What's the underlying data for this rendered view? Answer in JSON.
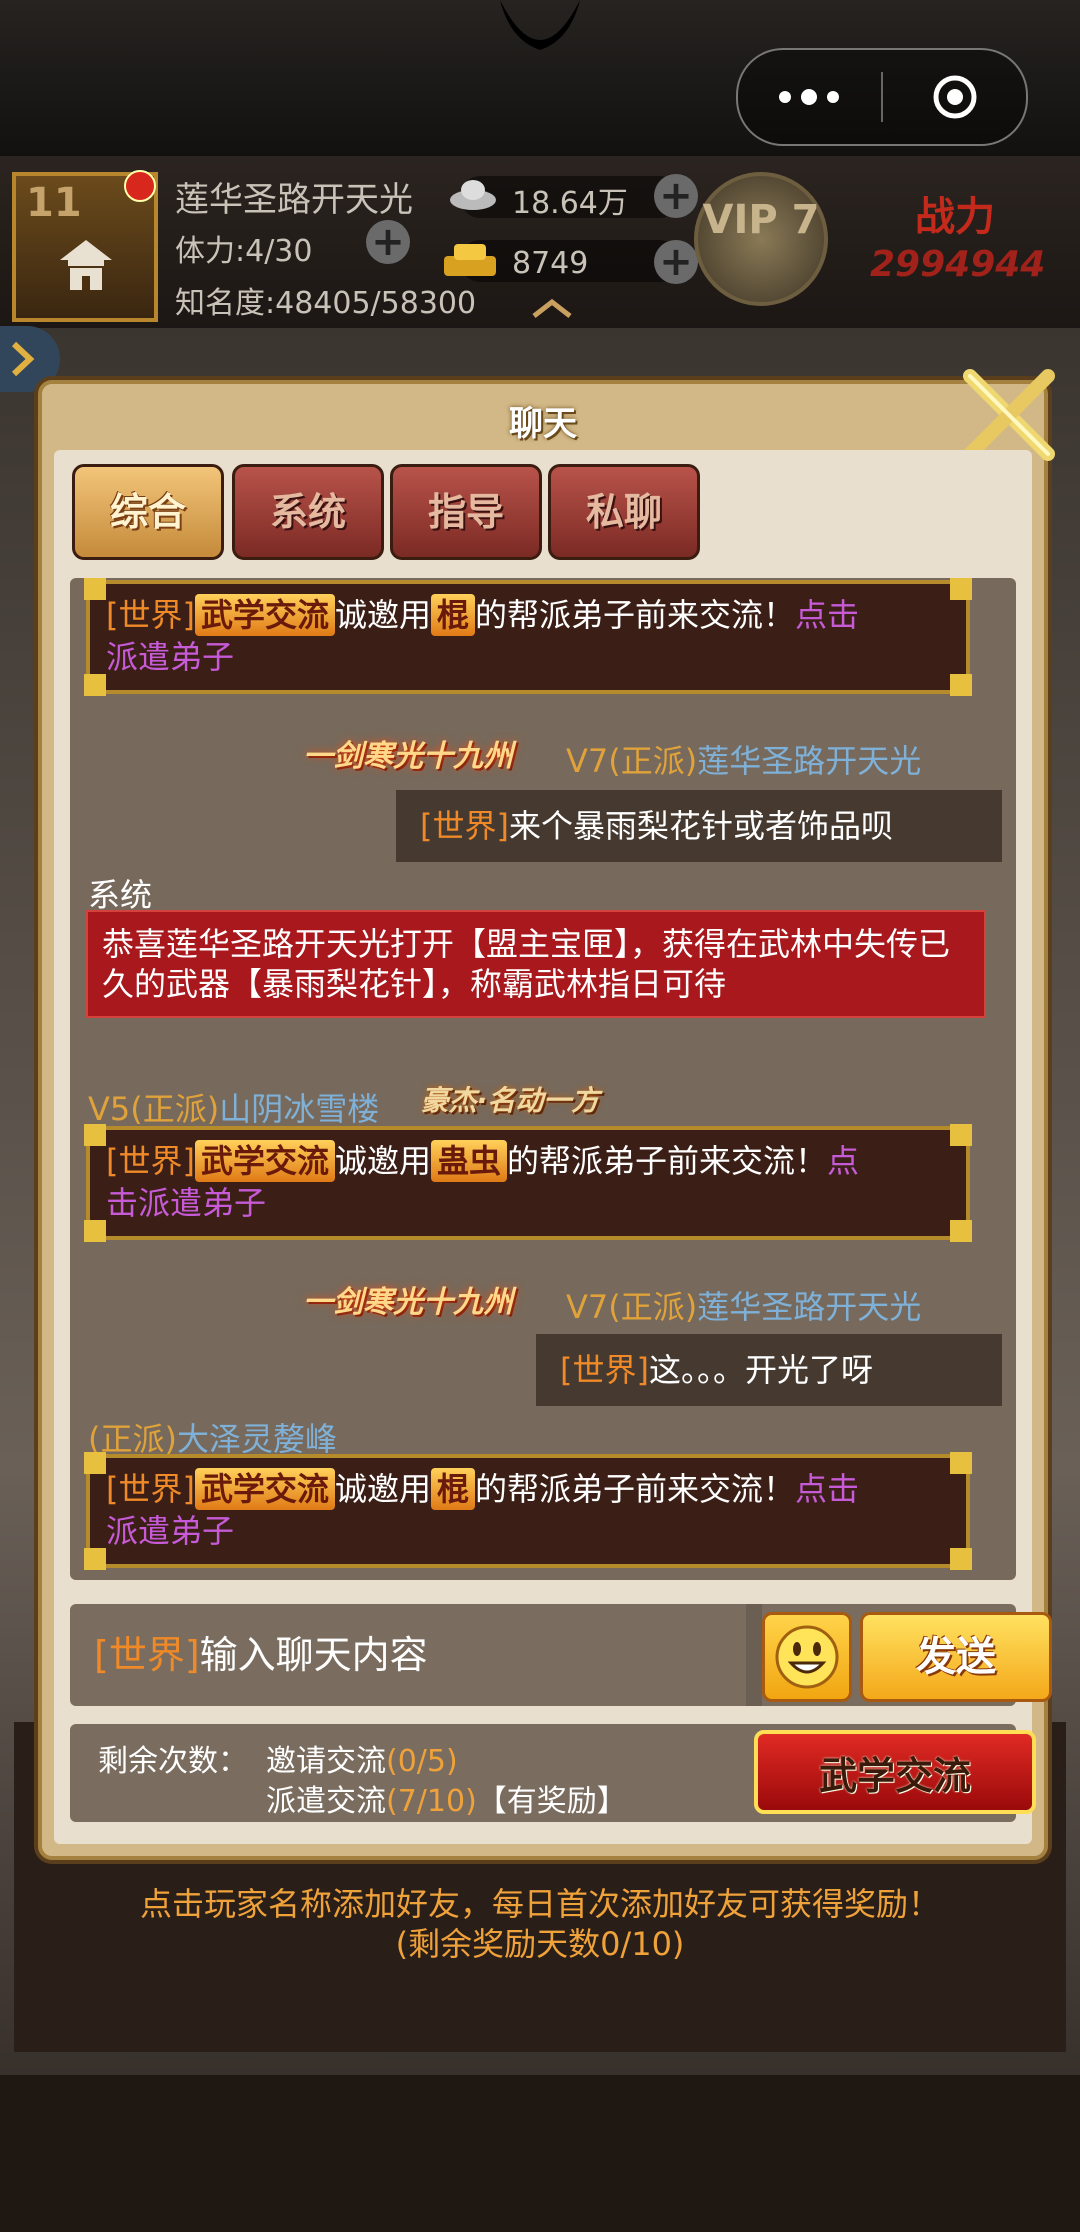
{
  "status": {
    "level": "11",
    "player_name": "莲华圣路开天光",
    "stamina": "体力:4/30",
    "fame": "知名度:48405/58300",
    "silver": "18.64万",
    "gold": "8749",
    "vip": "VIP 7",
    "power_label": "战力",
    "power_value": "2994944"
  },
  "dialog": {
    "title": "聊天",
    "tabs": [
      {
        "label": "综合",
        "active": true
      },
      {
        "label": "系统",
        "active": false
      },
      {
        "label": "指导",
        "active": false
      },
      {
        "label": "私聊",
        "active": false
      }
    ]
  },
  "messages": {
    "m1": {
      "channel": "[世界]",
      "badge": "武学交流",
      "pre": "诚邀用",
      "weapon": "棍",
      "post": "的帮派弟子前来交流！",
      "link1": "点击",
      "link2": "派遣弟子"
    },
    "m2": {
      "title": "一剑寒光十九州",
      "vip": "V7",
      "faction": "(正派)",
      "name": "莲华圣路开天光",
      "channel": "[世界]",
      "text": "来个暴雨梨花针或者饰品呗"
    },
    "m3": {
      "label": "系统",
      "text": "恭喜莲华圣路开天光打开【盟主宝匣】，获得在武林中失传已久的武器【暴雨梨花针】，称霸武林指日可待"
    },
    "m4": {
      "vip": "V5",
      "faction": "(正派)",
      "name": "山阴冰雪楼",
      "title": "豪杰·名动一方"
    },
    "m5": {
      "channel": "[世界]",
      "badge": "武学交流",
      "pre": "诚邀用",
      "weapon": "蛊虫",
      "post": "的帮派弟子前来交流！",
      "link1": "点",
      "link2": "击派遣弟子"
    },
    "m6": {
      "title": "一剑寒光十九州",
      "vip": "V7",
      "faction": "(正派)",
      "name": "莲华圣路开天光",
      "channel": "[世界]",
      "text": "这。。。开光了呀"
    },
    "m7": {
      "faction": "(正派)",
      "name": "大泽灵嫠峰"
    },
    "m8": {
      "channel": "[世界]",
      "badge": "武学交流",
      "pre": "诚邀用",
      "weapon": "棍",
      "post": "的帮派弟子前来交流！",
      "link1": "点击",
      "link2": "派遣弟子"
    }
  },
  "input": {
    "channel": "[世界]",
    "placeholder": "输入聊天内容",
    "send_label": "发送",
    "emoji_icon": "smiley-face-icon"
  },
  "info": {
    "remain_label": "剩余次数：",
    "invite_label": "邀请交流",
    "invite_count": "(0/5)",
    "dispatch_label": "派遣交流",
    "dispatch_count": "(7/10)",
    "reward": "【有奖励】",
    "wuxue_button": "武学交流"
  },
  "tip": {
    "line1": "点击玩家名称添加好友，每日首次添加好友可获得奖励！",
    "line2": "(剩余奖励天数0/10)"
  },
  "colors": {
    "channel_orange": "#f08a28",
    "link_purple": "#c65ad7",
    "name_blue": "#7fb1d8",
    "system_red": "#a8181c"
  }
}
